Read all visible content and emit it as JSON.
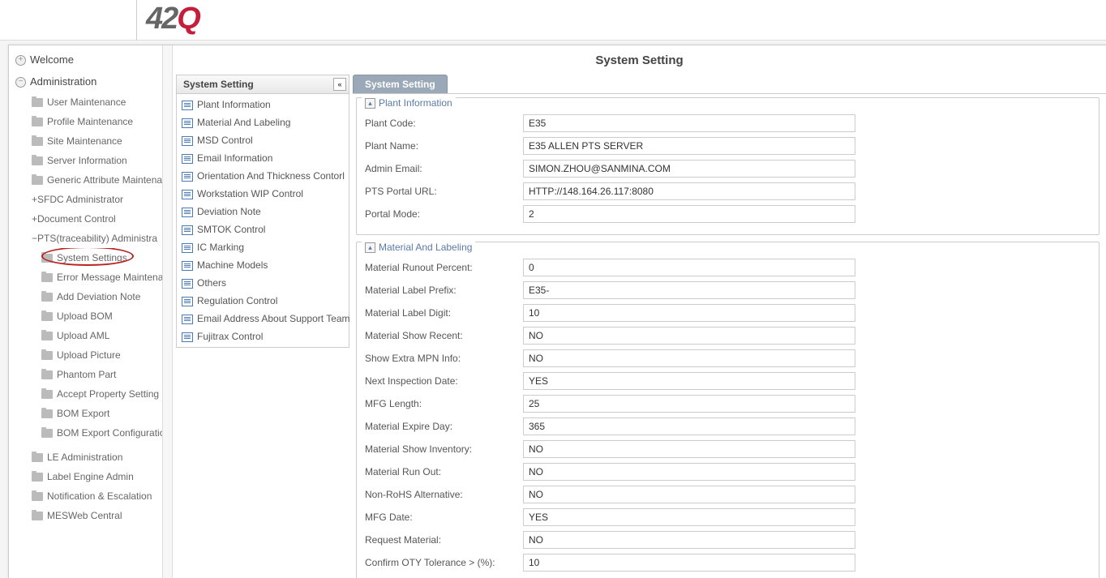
{
  "logo": {
    "part1": "42",
    "part2": "Q"
  },
  "leftNav": {
    "welcome": "Welcome",
    "admin": "Administration",
    "adminItems": [
      "User Maintenance",
      "Profile Maintenance",
      "Site Maintenance",
      "Server Information",
      "Generic Attribute Maintena"
    ],
    "sfdc": "SFDC Administrator",
    "docControl": "Document Control",
    "pts": "PTS(traceability) Administra",
    "ptsItems": [
      "System Settings",
      "Error Message Maintenance",
      "Add Deviation Note",
      "Upload BOM",
      "Upload AML",
      "Upload Picture",
      "Phantom Part",
      "Accept Property Setting",
      "BOM Export",
      "BOM Export Configuration"
    ],
    "bottomItems": [
      "LE Administration",
      "Label Engine Admin",
      "Notification & Escalation",
      "MESWeb Central"
    ]
  },
  "contentTitle": "System Setting",
  "midPanel": {
    "title": "System Setting",
    "items": [
      "Plant Information",
      "Material And Labeling",
      "MSD Control",
      "Email Information",
      "Orientation And Thickness Contorl",
      "Workstation WIP Control",
      "Deviation Note",
      "SMTOK Control",
      "IC Marking",
      "Machine Models",
      "Others",
      "Regulation Control",
      "Email Address About Support Team",
      "Fujitrax Control"
    ]
  },
  "tab": "System Setting",
  "fieldsets": [
    {
      "legend": "Plant Information",
      "rows": [
        {
          "label": "Plant Code:",
          "value": "E35"
        },
        {
          "label": "Plant Name:",
          "value": "E35 ALLEN PTS SERVER"
        },
        {
          "label": "Admin Email:",
          "value": "SIMON.ZHOU@SANMINA.COM"
        },
        {
          "label": "PTS Portal URL:",
          "value": "HTTP://148.164.26.117:8080"
        },
        {
          "label": "Portal Mode:",
          "value": "2"
        }
      ]
    },
    {
      "legend": "Material And Labeling",
      "rows": [
        {
          "label": "Material Runout Percent:",
          "value": "0"
        },
        {
          "label": "Material Label Prefix:",
          "value": "E35-"
        },
        {
          "label": "Material Label Digit:",
          "value": "10"
        },
        {
          "label": "Material Show Recent:",
          "value": "NO"
        },
        {
          "label": "Show Extra MPN Info:",
          "value": "NO"
        },
        {
          "label": "Next Inspection Date:",
          "value": "YES"
        },
        {
          "label": "MFG Length:",
          "value": "25"
        },
        {
          "label": "Material Expire Day:",
          "value": "365"
        },
        {
          "label": "Material Show Inventory:",
          "value": "NO"
        },
        {
          "label": "Material Run Out:",
          "value": "NO"
        },
        {
          "label": "Non-RoHS Alternative:",
          "value": "NO"
        },
        {
          "label": "MFG Date:",
          "value": "YES"
        },
        {
          "label": "Request Material:",
          "value": "NO"
        },
        {
          "label": "Confirm OTY Tolerance > (%):",
          "value": "10"
        }
      ]
    }
  ]
}
